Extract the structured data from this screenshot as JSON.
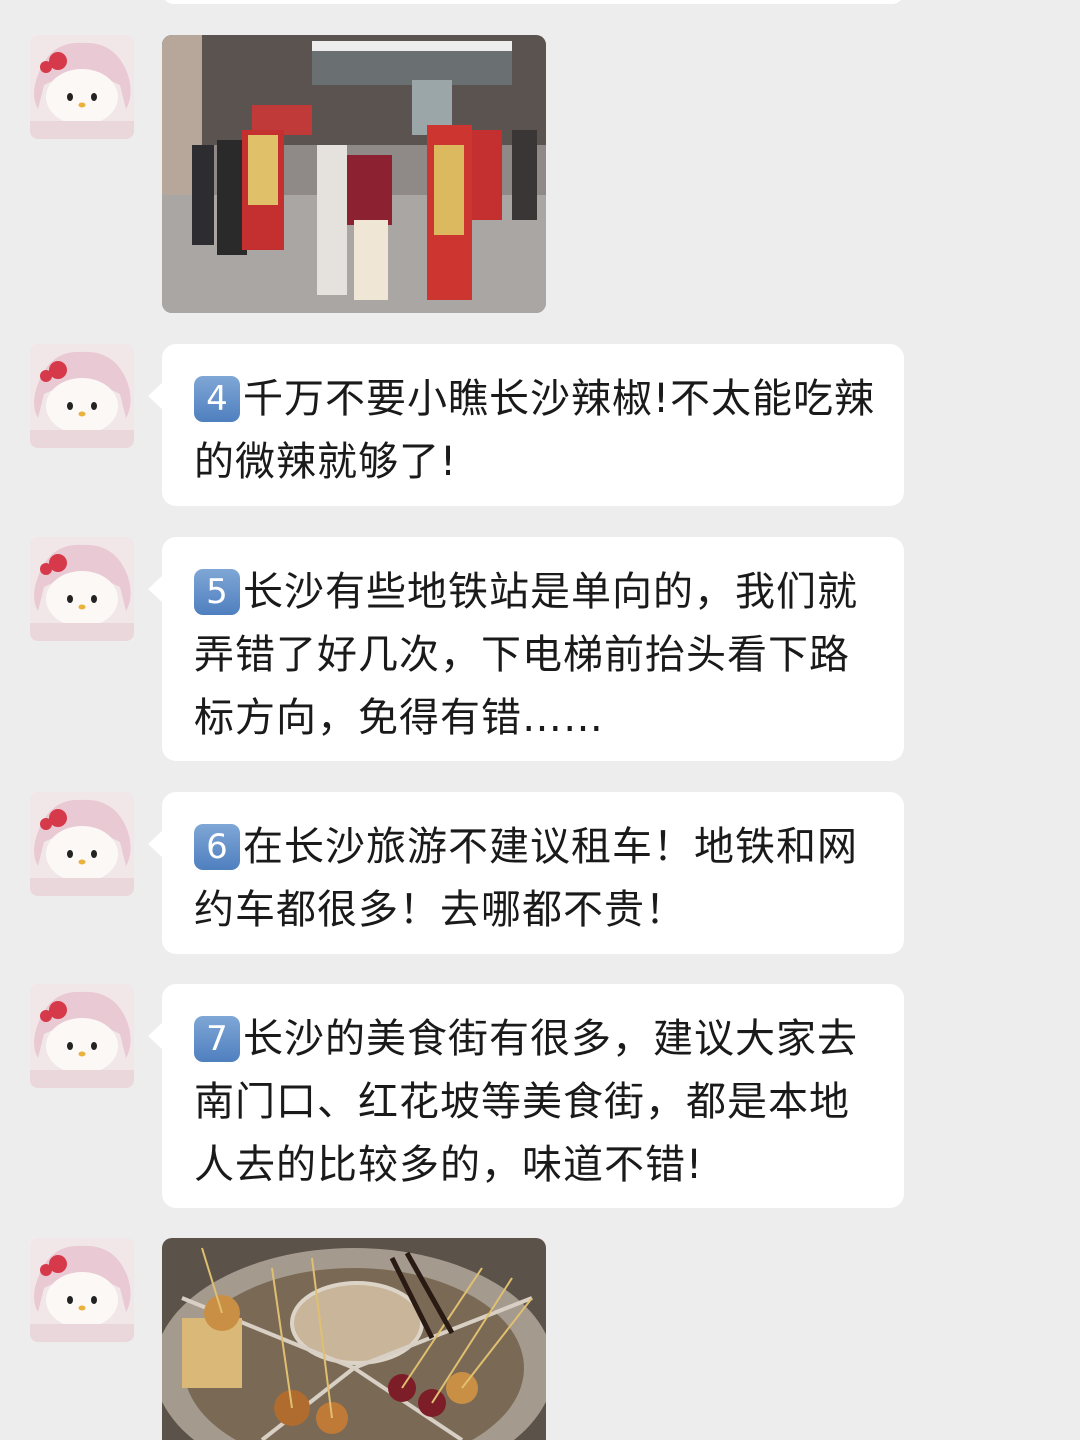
{
  "messages": [
    {
      "type": "image",
      "description_icon": "street-performers-photo"
    },
    {
      "type": "text",
      "number": "4",
      "text": "千万不要小瞧长沙辣椒!不太能吃辣的微辣就够了!"
    },
    {
      "type": "text",
      "number": "5",
      "text": "长沙有些地铁站是单向的，我们就弄错了好几次，下电梯前抬头看下路标方向，免得有错……"
    },
    {
      "type": "text",
      "number": "6",
      "text": "在长沙旅游不建议租车！地铁和网约车都很多！去哪都不贵！"
    },
    {
      "type": "text",
      "number": "7",
      "text": "长沙的美食街有很多，建议大家去南门口、红花坡等美食街，都是本地人去的比较多的，味道不错!"
    },
    {
      "type": "image",
      "description_icon": "skewers-hotpot-photo"
    }
  ],
  "avatar_icon": "hello-kitty-plush-icon",
  "colors": {
    "background": "#ededed",
    "bubble": "#ffffff",
    "text": "#1a1a1a",
    "badge": "#5f8cc8"
  }
}
